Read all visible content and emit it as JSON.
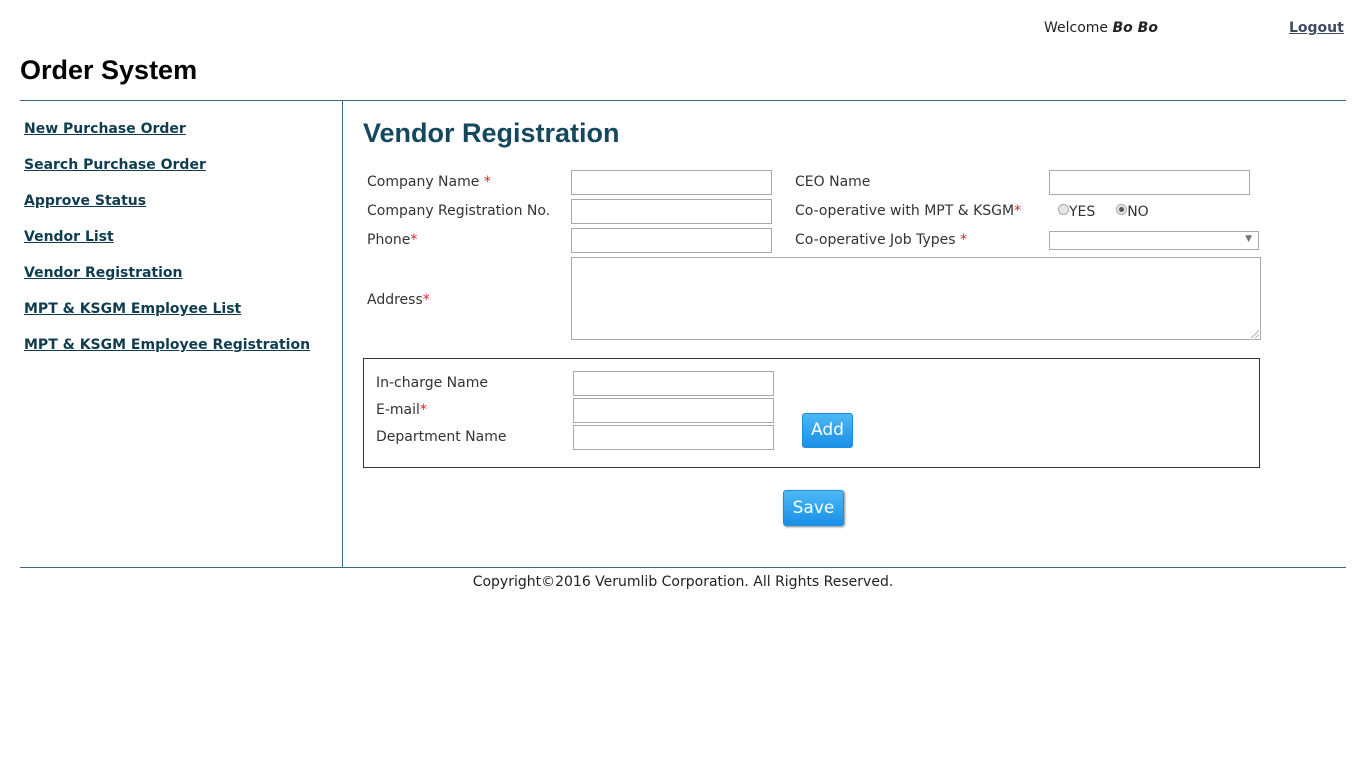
{
  "header": {
    "app_title": "Order System",
    "welcome_label": "Welcome",
    "user_name": "Bo Bo",
    "logout_label": "Logout"
  },
  "sidebar": {
    "items": [
      {
        "label": "New Purchase Order"
      },
      {
        "label": "Search Purchase Order"
      },
      {
        "label": "Approve Status"
      },
      {
        "label": "Vendor List"
      },
      {
        "label": "Vendor Registration"
      },
      {
        "label": "MPT & KSGM Employee List"
      },
      {
        "label": "MPT & KSGM Employee Registration"
      }
    ]
  },
  "form": {
    "title": "Vendor Registration",
    "required_mark": "*",
    "company_name": {
      "label": "Company Name ",
      "value": ""
    },
    "company_reg_no": {
      "label": "Company Registration No.",
      "value": ""
    },
    "phone": {
      "label": "Phone",
      "value": ""
    },
    "address": {
      "label": "Address",
      "value": ""
    },
    "ceo_name": {
      "label": "CEO Name",
      "value": ""
    },
    "cooperative": {
      "label": "Co-operative with MPT & KSGM",
      "options": [
        {
          "label": "YES",
          "checked": false
        },
        {
          "label": "NO",
          "checked": true
        }
      ]
    },
    "job_types": {
      "label": "Co-operative Job Types ",
      "value": "",
      "arrow": "▼"
    },
    "incharge": {
      "name": {
        "label": "In-charge Name",
        "value": ""
      },
      "email": {
        "label": "E-mail",
        "value": ""
      },
      "department": {
        "label": "Department Name",
        "value": ""
      },
      "add_label": "Add"
    },
    "save_label": "Save"
  },
  "footer": {
    "copyright": "Copyright©2016 Verumlib Corporation. All Rights Reserved."
  },
  "colors": {
    "accent_button": "#1a8fe8",
    "title": "#14485f",
    "link": "#0f3d4f",
    "required": "#d9232e",
    "divider": "#3c6a80"
  }
}
